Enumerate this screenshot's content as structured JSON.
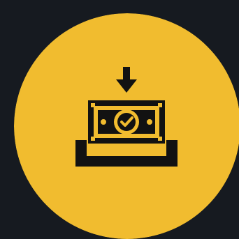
{
  "icon": {
    "name": "money-deposit-icon",
    "description_colors": {
      "background": "#161a20",
      "circle": "#f1bc2f",
      "glyph": "#121212"
    }
  }
}
